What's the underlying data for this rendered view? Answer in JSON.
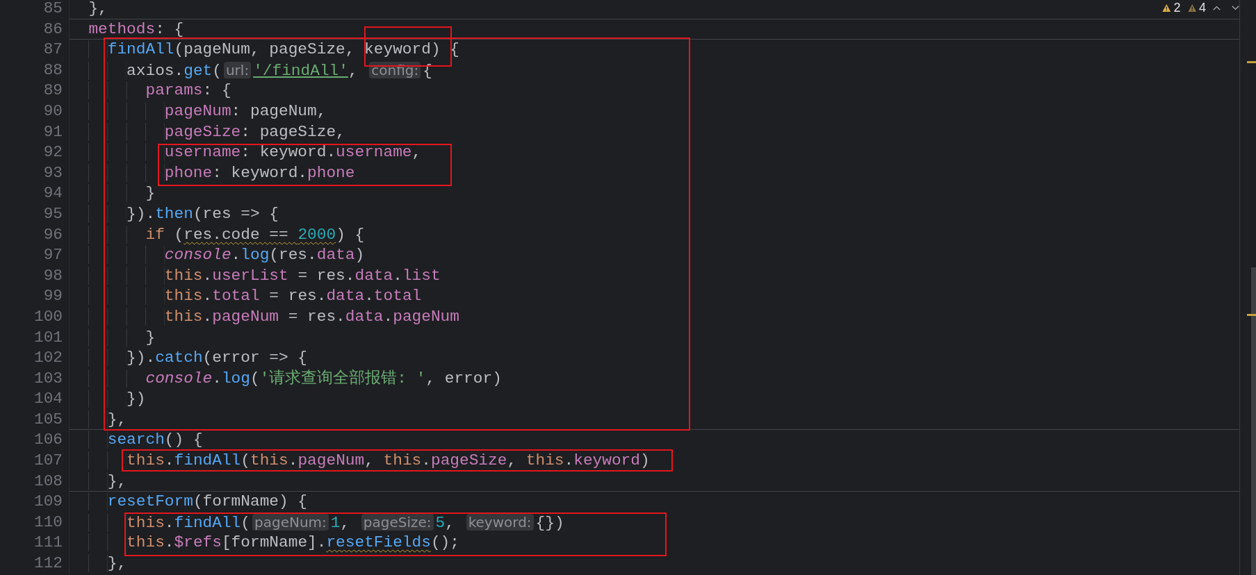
{
  "editor": {
    "lines": [
      {
        "number": "85",
        "tokens": [
          {
            "t": "  },",
            "kind": "plain"
          }
        ],
        "separator_after": true
      },
      {
        "number": "86",
        "tokens": [
          {
            "t": "  methods",
            "kind": "member"
          },
          {
            "t": ": {",
            "kind": "plain"
          }
        ],
        "separator_after": true
      },
      {
        "number": "87",
        "tokens": [
          {
            "t": "    findAll",
            "kind": "function"
          },
          {
            "t": "(pageNum, pageSize, keyword) {",
            "kind": "plain"
          }
        ]
      },
      {
        "number": "88",
        "tokens": [
          {
            "t": "      axios.",
            "kind": "plain"
          },
          {
            "t": "get",
            "kind": "function"
          },
          {
            "t": "(",
            "kind": "plain"
          },
          {
            "t": "url:",
            "kind": "hint"
          },
          {
            "t": "'/findAll'",
            "kind": "string",
            "link": true
          },
          {
            "t": ", ",
            "kind": "plain"
          },
          {
            "t": "config:",
            "kind": "hint"
          },
          {
            "t": "{",
            "kind": "plain"
          }
        ]
      },
      {
        "number": "89",
        "tokens": [
          {
            "t": "        params",
            "kind": "member"
          },
          {
            "t": ": {",
            "kind": "plain"
          }
        ]
      },
      {
        "number": "90",
        "tokens": [
          {
            "t": "          pageNum",
            "kind": "member"
          },
          {
            "t": ": pageNum,",
            "kind": "plain"
          }
        ]
      },
      {
        "number": "91",
        "tokens": [
          {
            "t": "          pageSize",
            "kind": "member"
          },
          {
            "t": ": pageSize,",
            "kind": "plain"
          }
        ]
      },
      {
        "number": "92",
        "tokens": [
          {
            "t": "          username",
            "kind": "member"
          },
          {
            "t": ": keyword.",
            "kind": "plain"
          },
          {
            "t": "username",
            "kind": "member"
          },
          {
            "t": ",",
            "kind": "plain"
          }
        ]
      },
      {
        "number": "93",
        "tokens": [
          {
            "t": "          phone",
            "kind": "member"
          },
          {
            "t": ": keyword.",
            "kind": "plain"
          },
          {
            "t": "phone",
            "kind": "member"
          }
        ]
      },
      {
        "number": "94",
        "tokens": [
          {
            "t": "        }",
            "kind": "plain"
          }
        ]
      },
      {
        "number": "95",
        "tokens": [
          {
            "t": "      }).",
            "kind": "plain"
          },
          {
            "t": "then",
            "kind": "function"
          },
          {
            "t": "(res => {",
            "kind": "plain"
          }
        ]
      },
      {
        "number": "96",
        "tokens": [
          {
            "t": "        if",
            "kind": "keyword"
          },
          {
            "t": " (",
            "kind": "plain"
          },
          {
            "t": "res.code == ",
            "kind": "plain",
            "warn": true
          },
          {
            "t": "2000",
            "kind": "number",
            "warn": true
          },
          {
            "t": ") {",
            "kind": "plain"
          }
        ]
      },
      {
        "number": "97",
        "tokens": [
          {
            "t": "          console",
            "kind": "console"
          },
          {
            "t": ".",
            "kind": "plain"
          },
          {
            "t": "log",
            "kind": "function"
          },
          {
            "t": "(res.",
            "kind": "plain"
          },
          {
            "t": "data",
            "kind": "member"
          },
          {
            "t": ")",
            "kind": "plain"
          }
        ]
      },
      {
        "number": "98",
        "tokens": [
          {
            "t": "          this",
            "kind": "keyword"
          },
          {
            "t": ".",
            "kind": "plain"
          },
          {
            "t": "userList",
            "kind": "member"
          },
          {
            "t": " = res.",
            "kind": "plain"
          },
          {
            "t": "data",
            "kind": "member"
          },
          {
            "t": ".",
            "kind": "plain"
          },
          {
            "t": "list",
            "kind": "member"
          }
        ]
      },
      {
        "number": "99",
        "tokens": [
          {
            "t": "          this",
            "kind": "keyword"
          },
          {
            "t": ".",
            "kind": "plain"
          },
          {
            "t": "total",
            "kind": "member"
          },
          {
            "t": " = res.",
            "kind": "plain"
          },
          {
            "t": "data",
            "kind": "member"
          },
          {
            "t": ".",
            "kind": "plain"
          },
          {
            "t": "total",
            "kind": "member"
          }
        ]
      },
      {
        "number": "100",
        "tokens": [
          {
            "t": "          this",
            "kind": "keyword"
          },
          {
            "t": ".",
            "kind": "plain"
          },
          {
            "t": "pageNum",
            "kind": "member"
          },
          {
            "t": " = res.",
            "kind": "plain"
          },
          {
            "t": "data",
            "kind": "member"
          },
          {
            "t": ".",
            "kind": "plain"
          },
          {
            "t": "pageNum",
            "kind": "member"
          }
        ]
      },
      {
        "number": "101",
        "tokens": [
          {
            "t": "        }",
            "kind": "plain"
          }
        ]
      },
      {
        "number": "102",
        "tokens": [
          {
            "t": "      }).",
            "kind": "plain"
          },
          {
            "t": "catch",
            "kind": "function"
          },
          {
            "t": "(error => {",
            "kind": "plain"
          }
        ]
      },
      {
        "number": "103",
        "tokens": [
          {
            "t": "        console",
            "kind": "console"
          },
          {
            "t": ".",
            "kind": "plain"
          },
          {
            "t": "log",
            "kind": "function"
          },
          {
            "t": "(",
            "kind": "plain"
          },
          {
            "t": "'请求查询全部报错: '",
            "kind": "string"
          },
          {
            "t": ", error)",
            "kind": "plain"
          }
        ]
      },
      {
        "number": "104",
        "tokens": [
          {
            "t": "      })",
            "kind": "plain"
          }
        ]
      },
      {
        "number": "105",
        "tokens": [
          {
            "t": "    },",
            "kind": "plain"
          }
        ],
        "separator_after": true
      },
      {
        "number": "106",
        "tokens": [
          {
            "t": "    search",
            "kind": "function"
          },
          {
            "t": "() {",
            "kind": "plain"
          }
        ]
      },
      {
        "number": "107",
        "tokens": [
          {
            "t": "      this",
            "kind": "keyword"
          },
          {
            "t": ".",
            "kind": "plain"
          },
          {
            "t": "findAll",
            "kind": "function"
          },
          {
            "t": "(",
            "kind": "plain"
          },
          {
            "t": "this",
            "kind": "keyword"
          },
          {
            "t": ".",
            "kind": "plain"
          },
          {
            "t": "pageNum",
            "kind": "member"
          },
          {
            "t": ", ",
            "kind": "plain"
          },
          {
            "t": "this",
            "kind": "keyword"
          },
          {
            "t": ".",
            "kind": "plain"
          },
          {
            "t": "pageSize",
            "kind": "member"
          },
          {
            "t": ", ",
            "kind": "plain"
          },
          {
            "t": "this",
            "kind": "keyword"
          },
          {
            "t": ".",
            "kind": "plain"
          },
          {
            "t": "keyword",
            "kind": "member"
          },
          {
            "t": ")",
            "kind": "plain"
          }
        ]
      },
      {
        "number": "108",
        "tokens": [
          {
            "t": "    },",
            "kind": "plain"
          }
        ],
        "separator_after": true
      },
      {
        "number": "109",
        "tokens": [
          {
            "t": "    resetForm",
            "kind": "function"
          },
          {
            "t": "(formName) {",
            "kind": "plain"
          }
        ]
      },
      {
        "number": "110",
        "tokens": [
          {
            "t": "      this",
            "kind": "keyword"
          },
          {
            "t": ".",
            "kind": "plain"
          },
          {
            "t": "findAll",
            "kind": "function"
          },
          {
            "t": "(",
            "kind": "plain"
          },
          {
            "t": "pageNum:",
            "kind": "hint"
          },
          {
            "t": "1",
            "kind": "number"
          },
          {
            "t": ", ",
            "kind": "plain"
          },
          {
            "t": "pageSize:",
            "kind": "hint"
          },
          {
            "t": "5",
            "kind": "number"
          },
          {
            "t": ", ",
            "kind": "plain"
          },
          {
            "t": "keyword:",
            "kind": "hint"
          },
          {
            "t": "{})",
            "kind": "plain"
          }
        ]
      },
      {
        "number": "111",
        "tokens": [
          {
            "t": "      this",
            "kind": "keyword"
          },
          {
            "t": ".",
            "kind": "plain"
          },
          {
            "t": "$refs",
            "kind": "member"
          },
          {
            "t": "[formName].",
            "kind": "plain"
          },
          {
            "t": "resetFields",
            "kind": "function",
            "warn": true
          },
          {
            "t": "();",
            "kind": "plain"
          }
        ]
      },
      {
        "number": "112",
        "tokens": [
          {
            "t": "    },",
            "kind": "plain"
          }
        ]
      }
    ]
  },
  "inspection_widget": {
    "items": [
      {
        "kind": "warning",
        "count": "2"
      },
      {
        "kind": "weak_warning",
        "count": "4"
      }
    ]
  }
}
